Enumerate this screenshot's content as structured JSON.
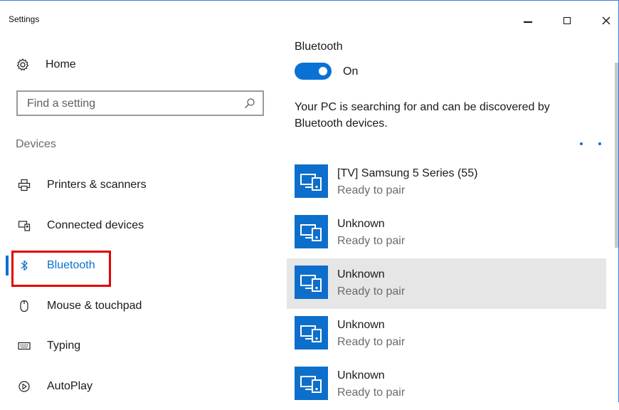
{
  "window": {
    "title": "Settings"
  },
  "controls": {
    "minimize": "minimize",
    "maximize": "maximize",
    "close": "close"
  },
  "sidebar": {
    "home_label": "Home",
    "search_placeholder": "Find a setting",
    "section_label": "Devices",
    "items": [
      {
        "label": "Printers & scanners",
        "icon": "printer-icon"
      },
      {
        "label": "Connected devices",
        "icon": "connected-devices-icon"
      },
      {
        "label": "Bluetooth",
        "icon": "bluetooth-icon",
        "active": true
      },
      {
        "label": "Mouse & touchpad",
        "icon": "mouse-icon"
      },
      {
        "label": "Typing",
        "icon": "keyboard-icon"
      },
      {
        "label": "AutoPlay",
        "icon": "autoplay-icon"
      }
    ]
  },
  "main": {
    "heading": "Bluetooth",
    "toggle": {
      "label": "On",
      "on": true
    },
    "description": "Your PC is searching for and can be discovered by Bluetooth devices.",
    "devices": [
      {
        "name": "[TV] Samsung 5 Series (55)",
        "status": "Ready to pair"
      },
      {
        "name": "Unknown",
        "status": "Ready to pair"
      },
      {
        "name": "Unknown",
        "status": "Ready to pair",
        "selected": true
      },
      {
        "name": "Unknown",
        "status": "Ready to pair"
      },
      {
        "name": "Unknown",
        "status": "Ready to pair"
      }
    ]
  },
  "colors": {
    "accent": "#0b6fd0",
    "highlight_box": "#e00000",
    "selected_row": "#e6e6e6",
    "device_tile": "#0d6fcb"
  }
}
